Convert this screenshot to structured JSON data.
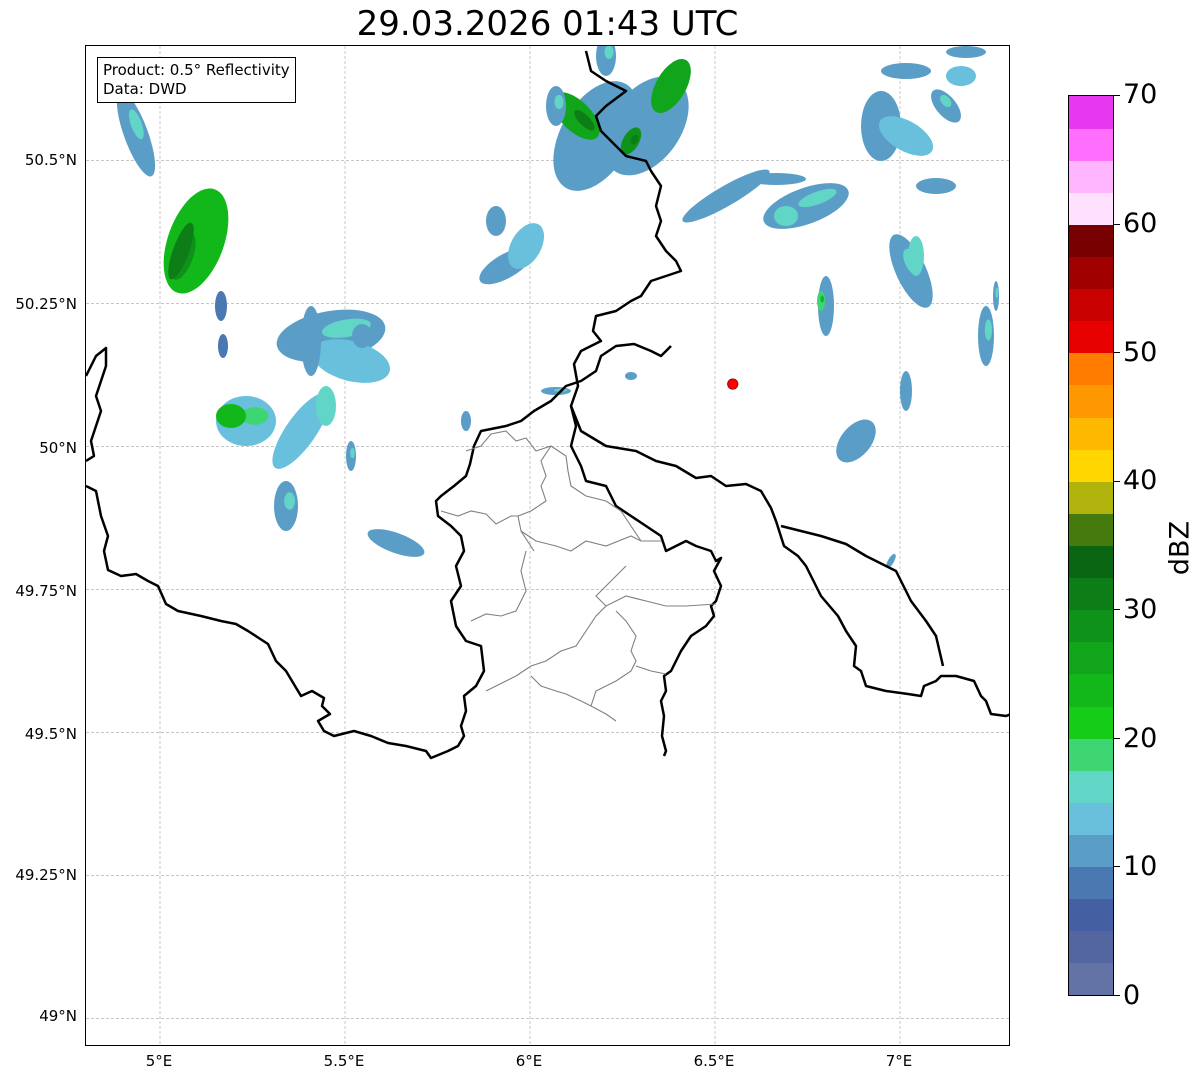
{
  "title": "29.03.2026 01:43 UTC",
  "info_box": {
    "product_line": "Product: 0.5° Reflectivity",
    "data_line": "Data: DWD"
  },
  "map": {
    "lat_labels": [
      "50.5°N",
      "50.25°N",
      "50°N",
      "49.75°N",
      "49.5°N",
      "49.25°N",
      "49°N"
    ],
    "lon_labels": [
      "5°E",
      "5.5°E",
      "6°E",
      "6.5°E",
      "7°E"
    ],
    "lat_values": [
      50.5,
      50.25,
      50.0,
      49.75,
      49.5,
      49.25,
      49.0
    ],
    "lon_values": [
      5.0,
      5.5,
      6.0,
      6.5,
      7.0
    ],
    "lon_range": [
      4.8,
      7.3
    ],
    "lat_range": [
      48.95,
      50.7
    ],
    "gridlines": "dashed",
    "radar_site": {
      "lon": 6.548,
      "lat": 50.109,
      "color": "#ff0000"
    },
    "border_color": "#000000",
    "district_color": "#808080"
  },
  "colorbar": {
    "label": "dBZ",
    "range": [
      0,
      70
    ],
    "tick_values": [
      0,
      10,
      20,
      30,
      40,
      50,
      60,
      70
    ],
    "tick_labels": [
      "0",
      "10",
      "20",
      "30",
      "40",
      "50",
      "60",
      "70"
    ],
    "colors": [
      "#6473a5",
      "#5466a0",
      "#4460a2",
      "#4a78b0",
      "#5a9ec8",
      "#68c0dc",
      "#62d6c6",
      "#3dd673",
      "#15cc18",
      "#12b71a",
      "#10a51a",
      "#0f921a",
      "#0d7d17",
      "#0a6612",
      "#457a0f",
      "#b0b30b",
      "#ffd600",
      "#ffb800",
      "#ff9800",
      "#ff7c00",
      "#e60000",
      "#c80000",
      "#a00000",
      "#780000",
      "#ffe0ff",
      "#ffb6ff",
      "#ff6efc",
      "#e838ef"
    ]
  }
}
